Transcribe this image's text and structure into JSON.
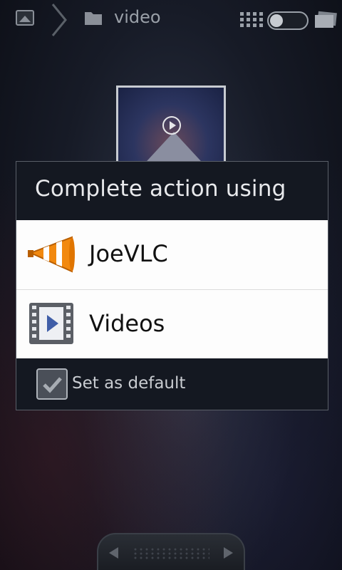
{
  "topbar": {
    "folder_label": "video",
    "icons": [
      "gallery-icon",
      "chevron-right-icon",
      "folder-icon",
      "grid-icon",
      "toggle-switch",
      "stack-icon"
    ]
  },
  "thumbnail": {
    "icon": "play-icon"
  },
  "dialog": {
    "title": "Complete action using",
    "options": [
      {
        "label": "JoeVLC",
        "icon": "vlc-cone-icon"
      },
      {
        "label": "Videos",
        "icon": "film-play-icon"
      }
    ],
    "default_checkbox": {
      "label": "Set as default",
      "checked": true
    }
  },
  "bottom_nav": {
    "icons": [
      "arrow-left-icon",
      "arrow-right-icon"
    ]
  }
}
